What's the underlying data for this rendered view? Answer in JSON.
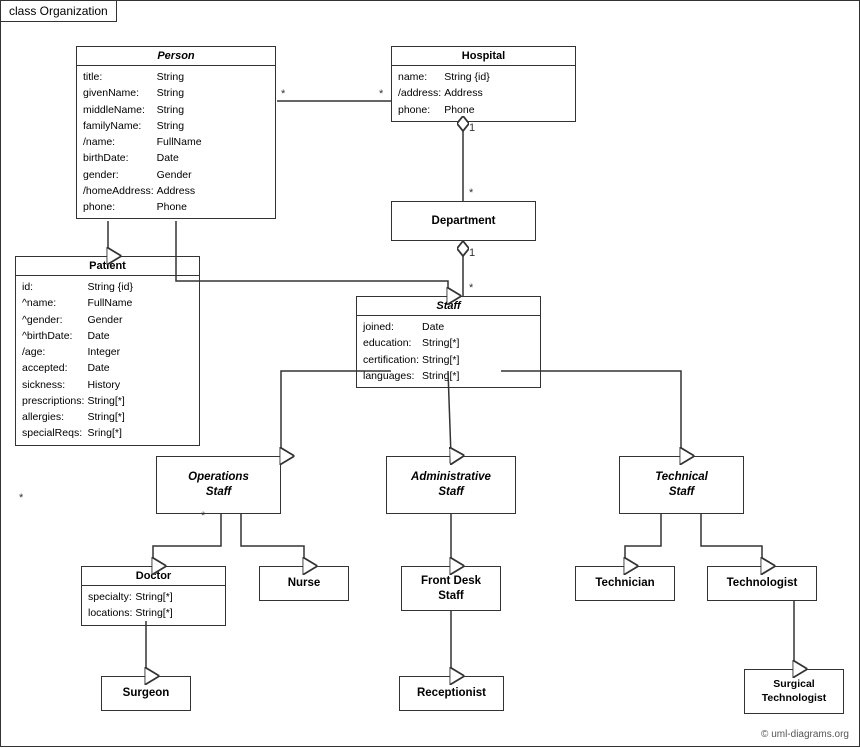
{
  "title": "class Organization",
  "copyright": "© uml-diagrams.org",
  "boxes": {
    "person": {
      "title": "Person",
      "attrs": [
        [
          "title:",
          "String"
        ],
        [
          "givenName:",
          "String"
        ],
        [
          "middleName:",
          "String"
        ],
        [
          "familyName:",
          "String"
        ],
        [
          "/name:",
          "FullName"
        ],
        [
          "birthDate:",
          "Date"
        ],
        [
          "gender:",
          "Gender"
        ],
        [
          "/homeAddress:",
          "Address"
        ],
        [
          "phone:",
          "Phone"
        ]
      ]
    },
    "hospital": {
      "title": "Hospital",
      "attrs": [
        [
          "name:",
          "String {id}"
        ],
        [
          "/address:",
          "Address"
        ],
        [
          "phone:",
          "Phone"
        ]
      ]
    },
    "patient": {
      "title": "Patient",
      "attrs": [
        [
          "id:",
          "String {id}"
        ],
        [
          "^name:",
          "FullName"
        ],
        [
          "^gender:",
          "Gender"
        ],
        [
          "^birthDate:",
          "Date"
        ],
        [
          "/age:",
          "Integer"
        ],
        [
          "accepted:",
          "Date"
        ],
        [
          "sickness:",
          "History"
        ],
        [
          "prescriptions:",
          "String[*]"
        ],
        [
          "allergies:",
          "String[*]"
        ],
        [
          "specialReqs:",
          "Sring[*]"
        ]
      ]
    },
    "department": {
      "title": "Department",
      "normal": true
    },
    "staff": {
      "title": "Staff",
      "attrs": [
        [
          "joined:",
          "Date"
        ],
        [
          "education:",
          "String[*]"
        ],
        [
          "certification:",
          "String[*]"
        ],
        [
          "languages:",
          "String[*]"
        ]
      ]
    },
    "operations_staff": {
      "title": "Operations\nStaff",
      "italic": true
    },
    "administrative_staff": {
      "title": "Administrative\nStaff",
      "italic": true
    },
    "technical_staff": {
      "title": "Technical\nStaff",
      "italic": true
    },
    "doctor": {
      "title": "Doctor",
      "attrs": [
        [
          "specialty:",
          "String[*]"
        ],
        [
          "locations:",
          "String[*]"
        ]
      ]
    },
    "nurse": {
      "title": "Nurse"
    },
    "front_desk_staff": {
      "title": "Front Desk\nStaff"
    },
    "technician": {
      "title": "Technician"
    },
    "technologist": {
      "title": "Technologist"
    },
    "surgeon": {
      "title": "Surgeon"
    },
    "receptionist": {
      "title": "Receptionist"
    },
    "surgical_technologist": {
      "title": "Surgical\nTechnologist"
    }
  }
}
